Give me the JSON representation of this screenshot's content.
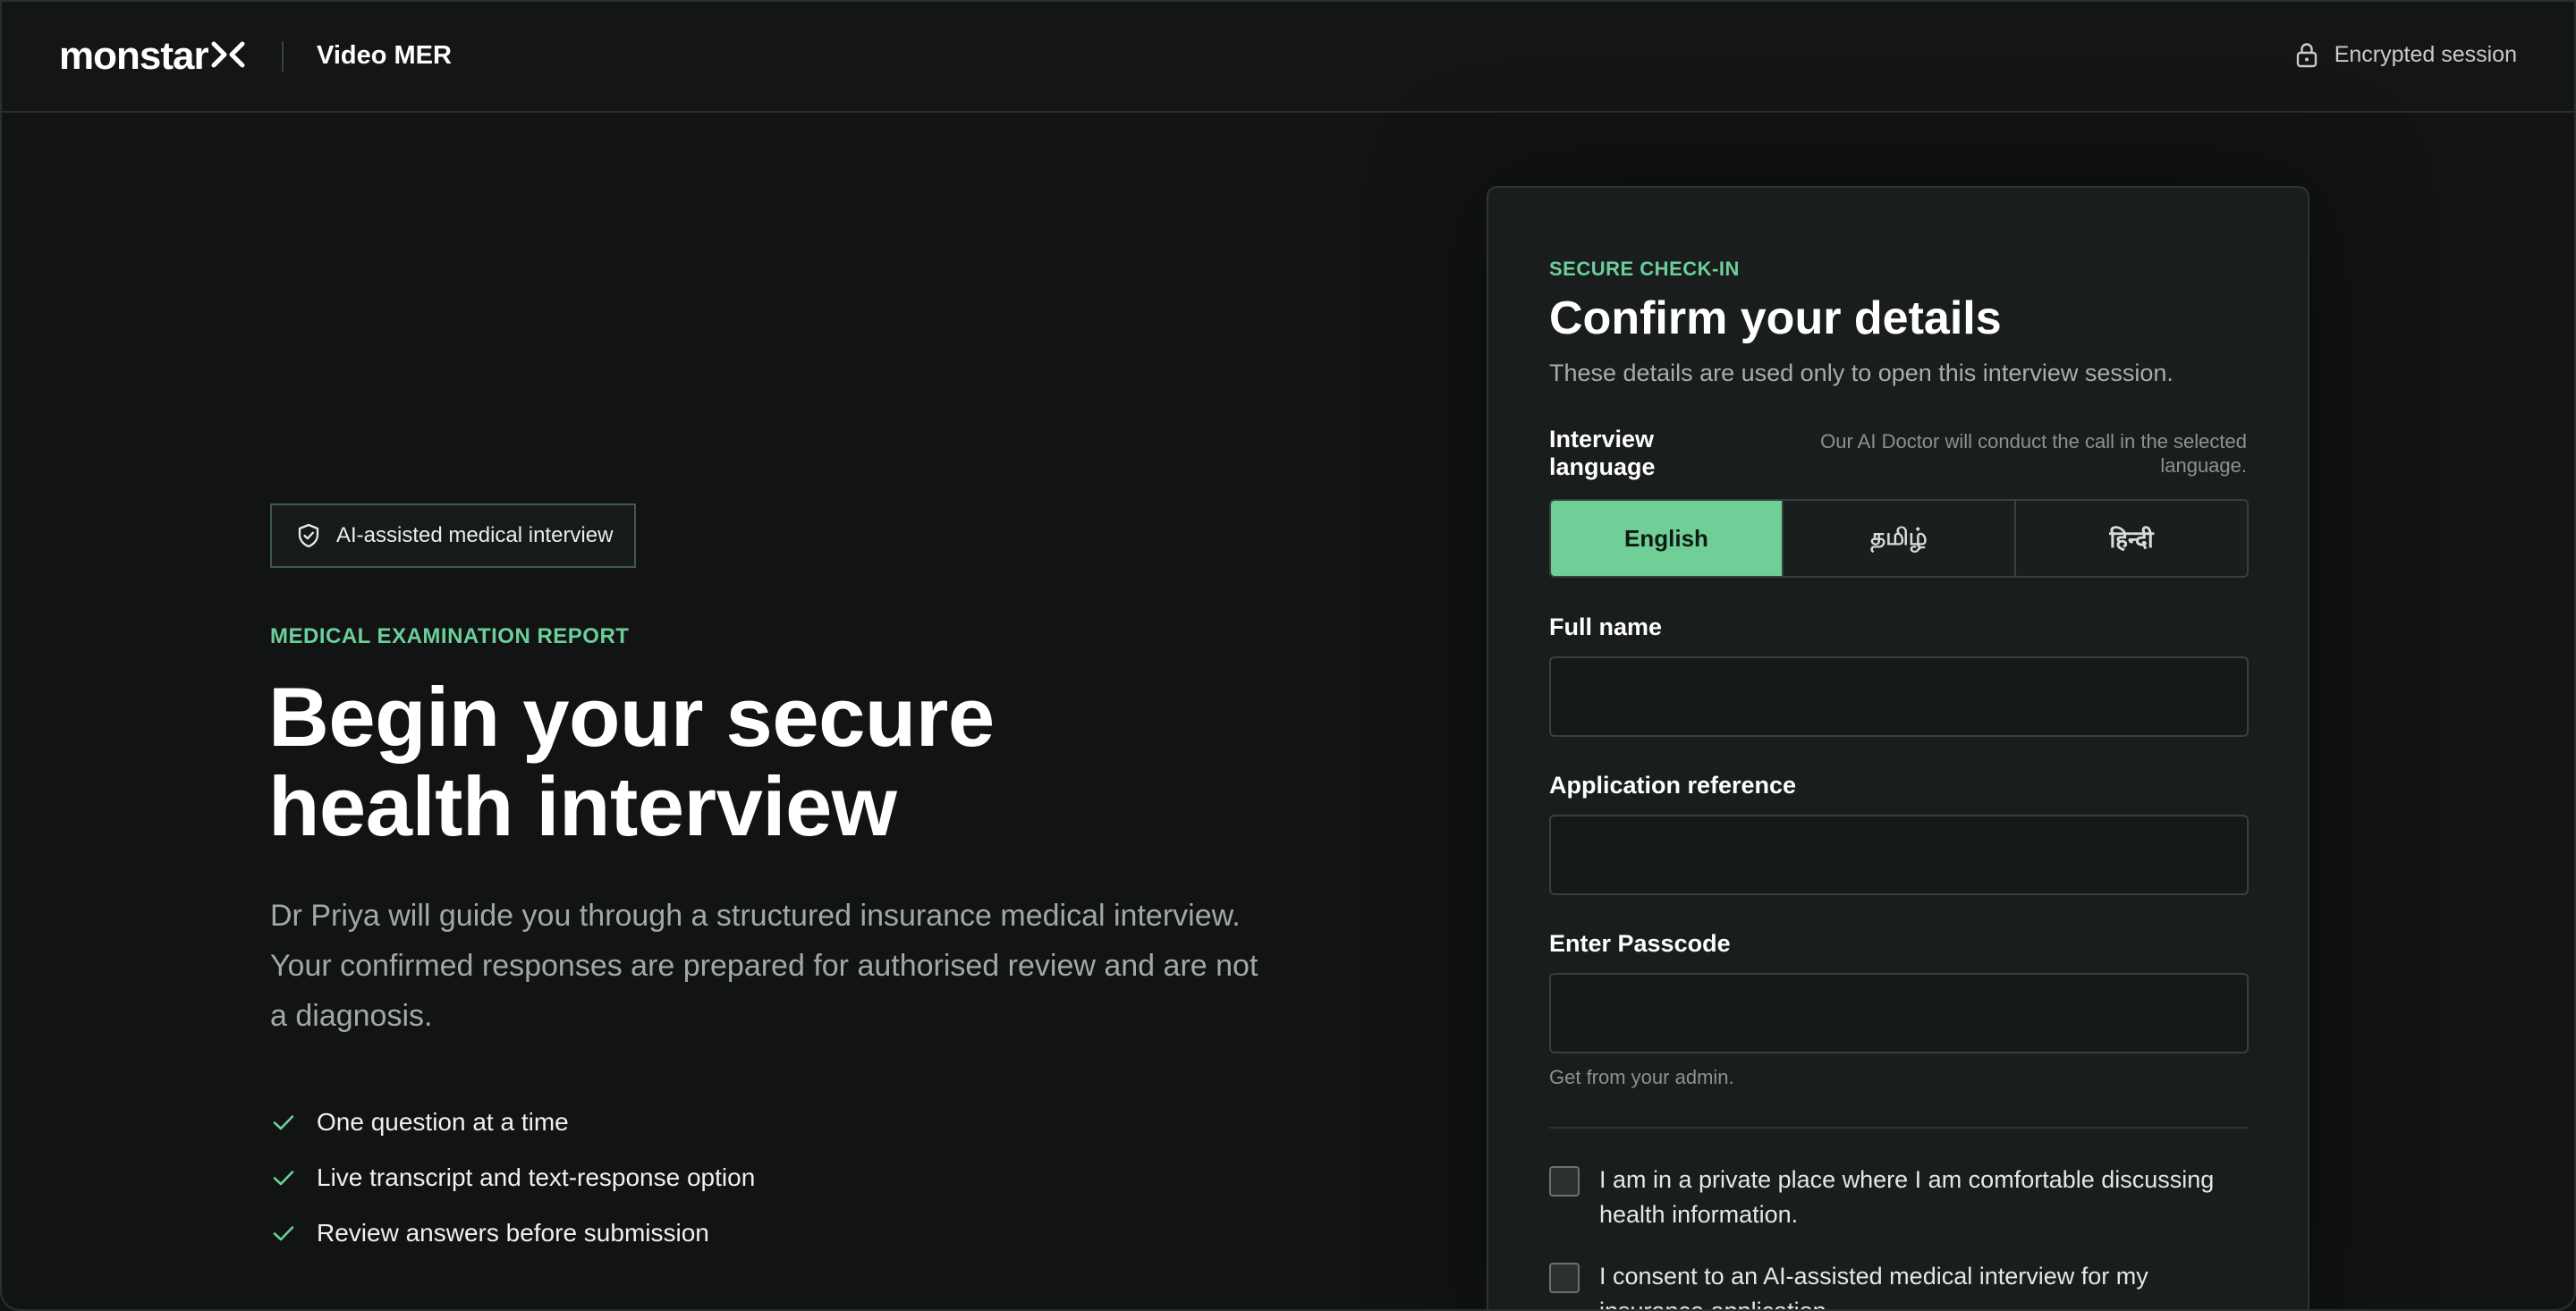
{
  "header": {
    "logo_text": "monstar",
    "logo_mark": "X",
    "product_name": "Video MER",
    "session_icon": "lock-icon",
    "session_label": "Encrypted session"
  },
  "hero": {
    "badge_icon": "shield-check-icon",
    "badge_label": "AI-assisted medical interview",
    "eyebrow": "MEDICAL EXAMINATION REPORT",
    "title_line1": "Begin your secure",
    "title_line2": "health interview",
    "description": "Dr Priya will guide you through a structured insurance medical interview. Your confirmed responses are prepared for authorised review and are not a diagnosis.",
    "features": [
      {
        "icon": "check-icon",
        "label": "One question at a time"
      },
      {
        "icon": "check-icon",
        "label": "Live transcript and text-response option"
      },
      {
        "icon": "check-icon",
        "label": "Review answers before submission"
      }
    ]
  },
  "checkin": {
    "eyebrow": "SECURE CHECK-IN",
    "title": "Confirm your details",
    "subtitle": "These details are used only to open this interview session.",
    "language_label": "Interview language",
    "language_hint": "Our AI Doctor will conduct the call in the selected language.",
    "languages": [
      {
        "label": "English",
        "selected": true
      },
      {
        "label": "தமிழ்",
        "selected": false
      },
      {
        "label": "हिन्दी",
        "selected": false
      }
    ],
    "full_name_label": "Full name",
    "full_name_value": "",
    "full_name_placeholder": "",
    "app_ref_label": "Application reference",
    "app_ref_value": "",
    "app_ref_placeholder": "",
    "passcode_label": "Enter Passcode",
    "passcode_value": "",
    "passcode_placeholder": "",
    "passcode_helper": "Get from your admin.",
    "consents": [
      {
        "label": "I am in a private place where I am comfortable discussing health information.",
        "checked": false
      },
      {
        "label": "I consent to an AI-assisted medical interview for my insurance application.",
        "checked": false
      }
    ]
  },
  "colors": {
    "accent": "#6fcf97",
    "background": "#121414",
    "card": "#1a1d1d",
    "muted_text": "#a3a8a6"
  }
}
